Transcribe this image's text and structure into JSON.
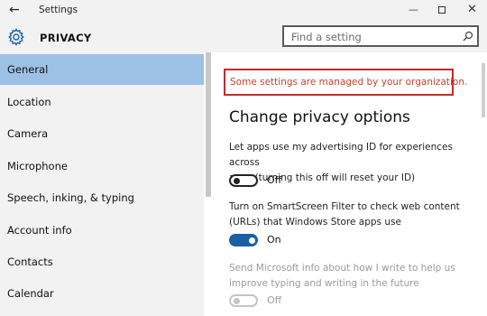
{
  "window": {
    "title": "Settings",
    "back_glyph": "←",
    "minimize_glyph": "—",
    "close_glyph": "✕"
  },
  "header": {
    "icon": "gear-icon",
    "title": "PRIVACY",
    "search_placeholder": "Find a setting"
  },
  "sidebar": {
    "items": [
      {
        "label": "General",
        "active": true
      },
      {
        "label": "Location",
        "active": false
      },
      {
        "label": "Camera",
        "active": false
      },
      {
        "label": "Microphone",
        "active": false
      },
      {
        "label": "Speech, inking, & typing",
        "active": false
      },
      {
        "label": "Account info",
        "active": false
      },
      {
        "label": "Contacts",
        "active": false
      },
      {
        "label": "Calendar",
        "active": false
      }
    ]
  },
  "main": {
    "notice": "Some settings are managed by your organization.",
    "heading": "Change privacy options",
    "settings": [
      {
        "description_lines": [
          "Let apps use my advertising ID for experiences across",
          "apps (turning this off will reset your ID)"
        ],
        "state": "Off",
        "enabled": true,
        "on": false
      },
      {
        "description_lines": [
          "Turn on SmartScreen Filter to check web content",
          "(URLs) that Windows Store apps use"
        ],
        "state": "On",
        "enabled": true,
        "on": true
      },
      {
        "description_lines": [
          "Send Microsoft info about how I write to help us",
          "improve typing and writing in the future"
        ],
        "state": "Off",
        "enabled": false,
        "on": false
      }
    ]
  },
  "colors": {
    "accent": "#1c5fa5",
    "selection": "#9cc1e4",
    "notice_border": "#c52a2a",
    "notice_text": "#c8412b"
  }
}
